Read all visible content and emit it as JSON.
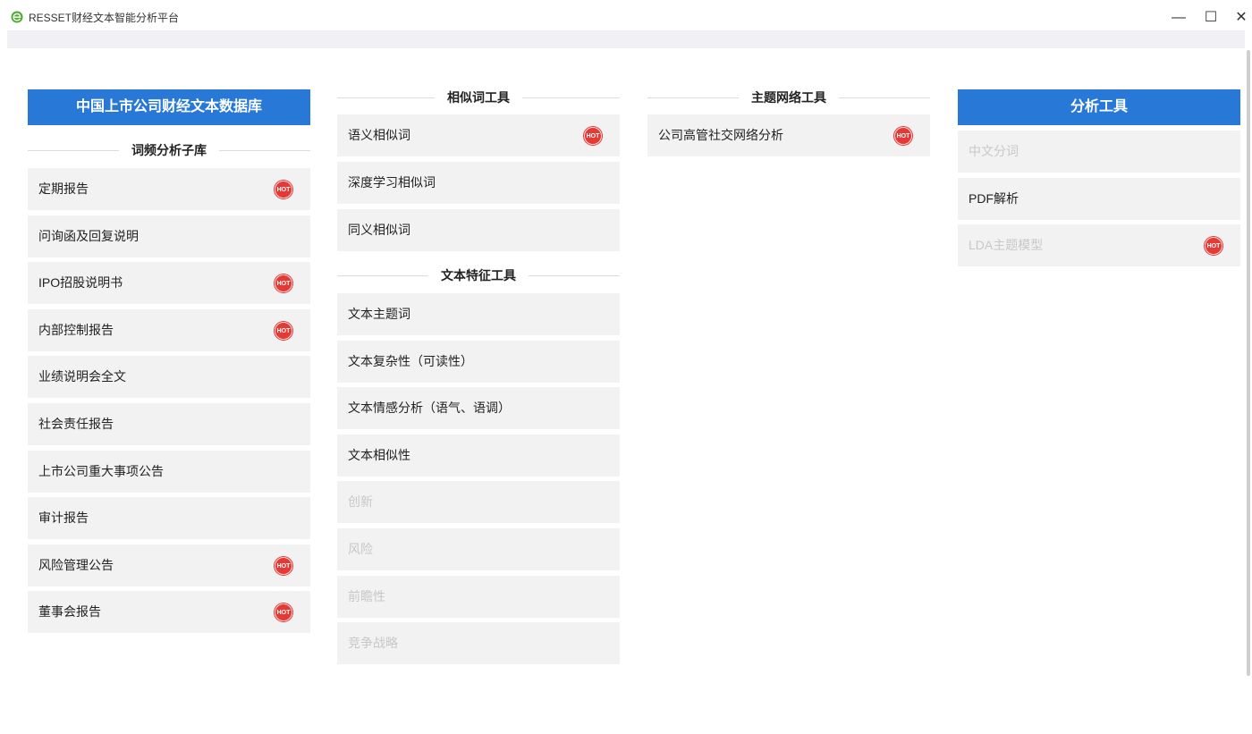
{
  "window": {
    "title": "RESSET财经文本智能分析平台",
    "controls": {
      "minimize": "—",
      "maximize": "☐",
      "close": "✕"
    }
  },
  "hot_label": "HOT",
  "col1": {
    "header": "中国上市公司财经文本数据库",
    "section": "词频分析子库",
    "items": [
      {
        "label": "定期报告",
        "hot": true
      },
      {
        "label": "问询函及回复说明",
        "hot": false
      },
      {
        "label": "IPO招股说明书",
        "hot": true
      },
      {
        "label": "内部控制报告",
        "hot": true
      },
      {
        "label": "业绩说明会全文",
        "hot": false
      },
      {
        "label": "社会责任报告",
        "hot": false
      },
      {
        "label": "上市公司重大事项公告",
        "hot": false
      },
      {
        "label": "审计报告",
        "hot": false
      },
      {
        "label": "风险管理公告",
        "hot": true
      },
      {
        "label": "董事会报告",
        "hot": true
      }
    ]
  },
  "col2": {
    "section1": "相似词工具",
    "items1": [
      {
        "label": "语义相似词",
        "hot": true
      },
      {
        "label": "深度学习相似词",
        "hot": false
      },
      {
        "label": "同义相似词",
        "hot": false
      }
    ],
    "section2": "文本特征工具",
    "items2": [
      {
        "label": "文本主题词",
        "disabled": false
      },
      {
        "label": "文本复杂性（可读性）",
        "disabled": false
      },
      {
        "label": "文本情感分析（语气、语调）",
        "disabled": false
      },
      {
        "label": "文本相似性",
        "disabled": false
      },
      {
        "label": "创新",
        "disabled": true
      },
      {
        "label": "风险",
        "disabled": true
      },
      {
        "label": "前瞻性",
        "disabled": true
      },
      {
        "label": "竞争战略",
        "disabled": true
      }
    ]
  },
  "col3": {
    "section": "主题网络工具",
    "items": [
      {
        "label": "公司高管社交网络分析",
        "hot": true
      }
    ]
  },
  "col4": {
    "header": "分析工具",
    "items": [
      {
        "label": "中文分词",
        "disabled": true,
        "hot": false
      },
      {
        "label": "PDF解析",
        "disabled": false,
        "hot": false
      },
      {
        "label": "LDA主题模型",
        "disabled": true,
        "hot": true
      }
    ]
  },
  "colors": {
    "accent": "#2878d8",
    "hot": "#e53935",
    "item_bg": "#f2f2f2",
    "disabled_text": "#c8c8c8"
  },
  "icons": {
    "app": "ie-logo-icon"
  }
}
